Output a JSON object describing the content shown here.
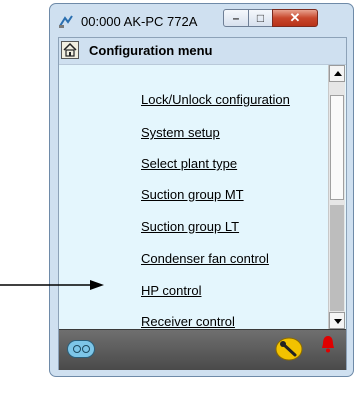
{
  "window": {
    "title": "00:000 AK-PC 772A",
    "controls": {
      "minimize": "–",
      "maximize": "□",
      "close": "✕"
    }
  },
  "header": {
    "title": "Configuration menu",
    "home_icon": "home-icon"
  },
  "menu": {
    "items": [
      {
        "label": "Lock/Unlock configuration"
      },
      {
        "label": "System setup"
      },
      {
        "label": "Select plant type"
      },
      {
        "label": "Suction group MT"
      },
      {
        "label": "Suction group LT"
      },
      {
        "label": "Condenser fan control"
      },
      {
        "label": "HP control"
      },
      {
        "label": "Receiver control"
      }
    ]
  },
  "statusbar": {
    "left_icon": "controller-icon",
    "tool_icon": "wrench-icon",
    "alarm_icon": "alarm-bell-icon"
  },
  "annotation": {
    "arrow_target": "HP control"
  },
  "colors": {
    "window_frame": "#cfe0f0",
    "list_background": "#e4f6fd",
    "status_bar": "#5a5a5a",
    "close_button": "#c8472c",
    "alarm": "#e00000",
    "tool_icon": "#f2c200"
  }
}
